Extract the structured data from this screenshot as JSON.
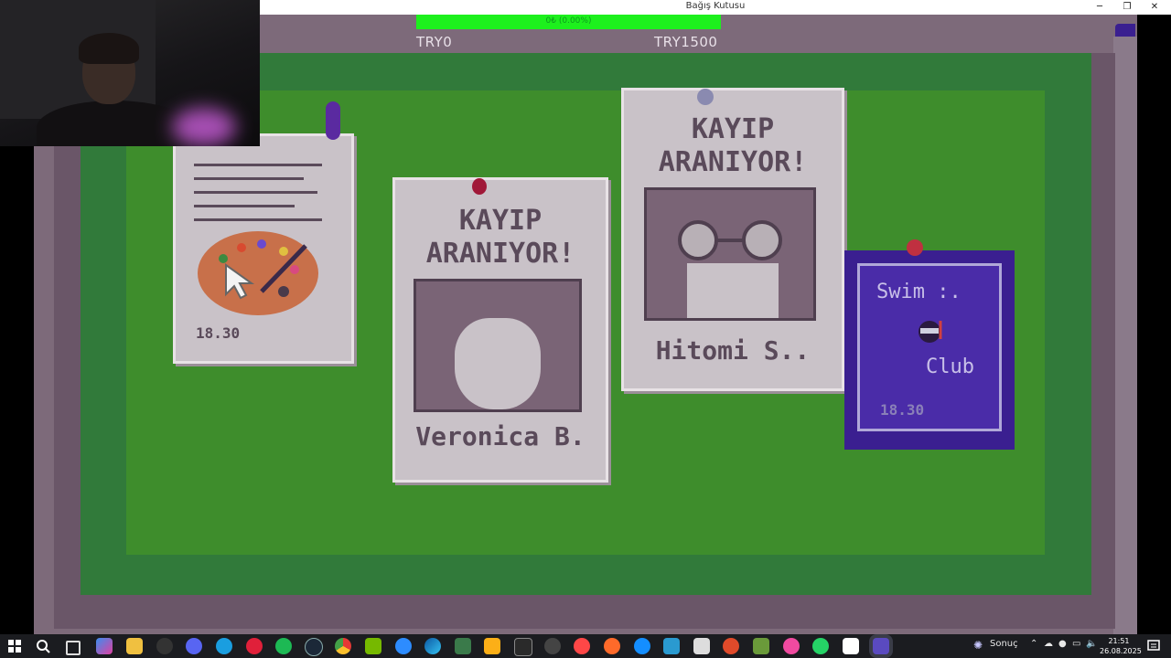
{
  "window": {
    "title": "Bağış Kutusu",
    "controls": {
      "minimize": "─",
      "maximize": "❐",
      "close": "✕"
    }
  },
  "donation": {
    "progress_text": "0₺ (0.00%)",
    "progress_fraction": 0,
    "min_label": "TRY0",
    "max_label": "TRY1500",
    "color": "#1df01d"
  },
  "posters": {
    "art": {
      "time": "18.30",
      "icon": "paint-palette-icon"
    },
    "veronica": {
      "title_line1": "KAYIP",
      "title_line2": "ARANIYOR!",
      "name": "Veronica B."
    },
    "hitomi": {
      "title_line1": "KAYIP",
      "title_line2": "ARANIYOR!",
      "name": "Hitomi S.."
    },
    "swim": {
      "title": "Swim :.",
      "subtitle": "Club",
      "time": "18.30"
    }
  },
  "taskbar": {
    "search_label": "Sonuç",
    "time": "21:51",
    "date": "26.08.2025"
  },
  "colors": {
    "board_green": "#3e8d2c",
    "frame_purple": "#7d6a7a",
    "swim_poster": "#3a1f90"
  }
}
